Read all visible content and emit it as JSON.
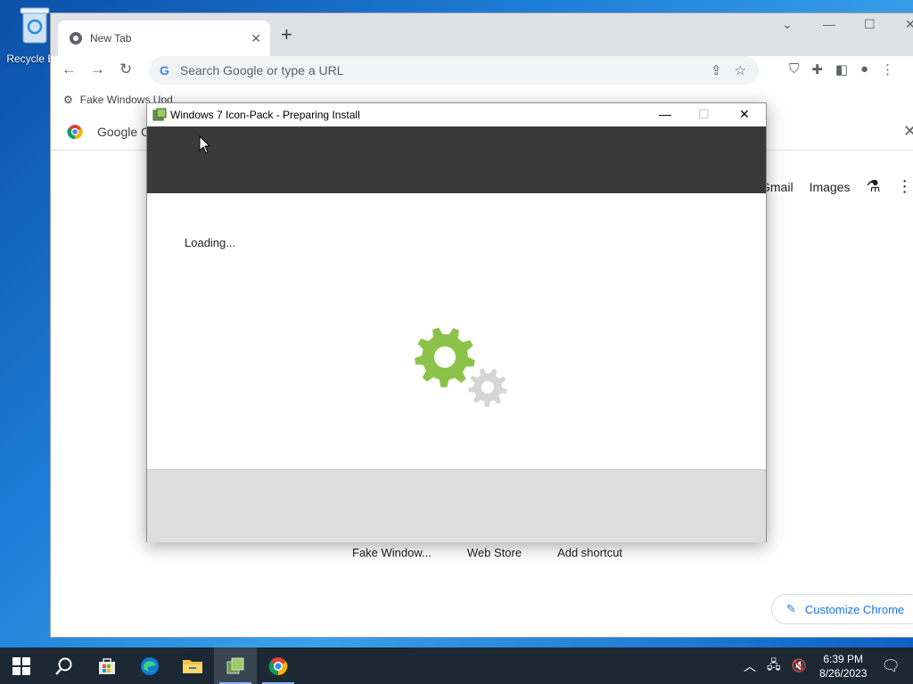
{
  "desktop": {
    "recycle_label": "Recycle Bin"
  },
  "chrome": {
    "tab_title": "New Tab",
    "tab_close": "✕",
    "new_tab": "+",
    "omnibox_placeholder": "Search Google or type a URL",
    "bookmark_label": "Fake Windows Upd",
    "infobar_text": "Google Chrome",
    "gbar": {
      "gmail": "Gmail",
      "images": "Images"
    },
    "shortcuts": [
      "Fake Window...",
      "Web Store",
      "Add shortcut"
    ],
    "customize_label": "Customize Chrome"
  },
  "installer": {
    "title": "Windows 7 Icon-Pack - Preparing Install",
    "loading_text": "Loading...",
    "header_color": "#3a3a3a",
    "gear_color": "#8bc34a",
    "gear_small_color": "#d6d6d6"
  },
  "taskbar": {
    "apps": [
      "start-icon",
      "search-icon",
      "store-icon",
      "edge-icon",
      "file-explorer-icon",
      "installer-icon",
      "chrome-icon"
    ],
    "time": "6:39 PM",
    "date": "8/26/2023"
  }
}
